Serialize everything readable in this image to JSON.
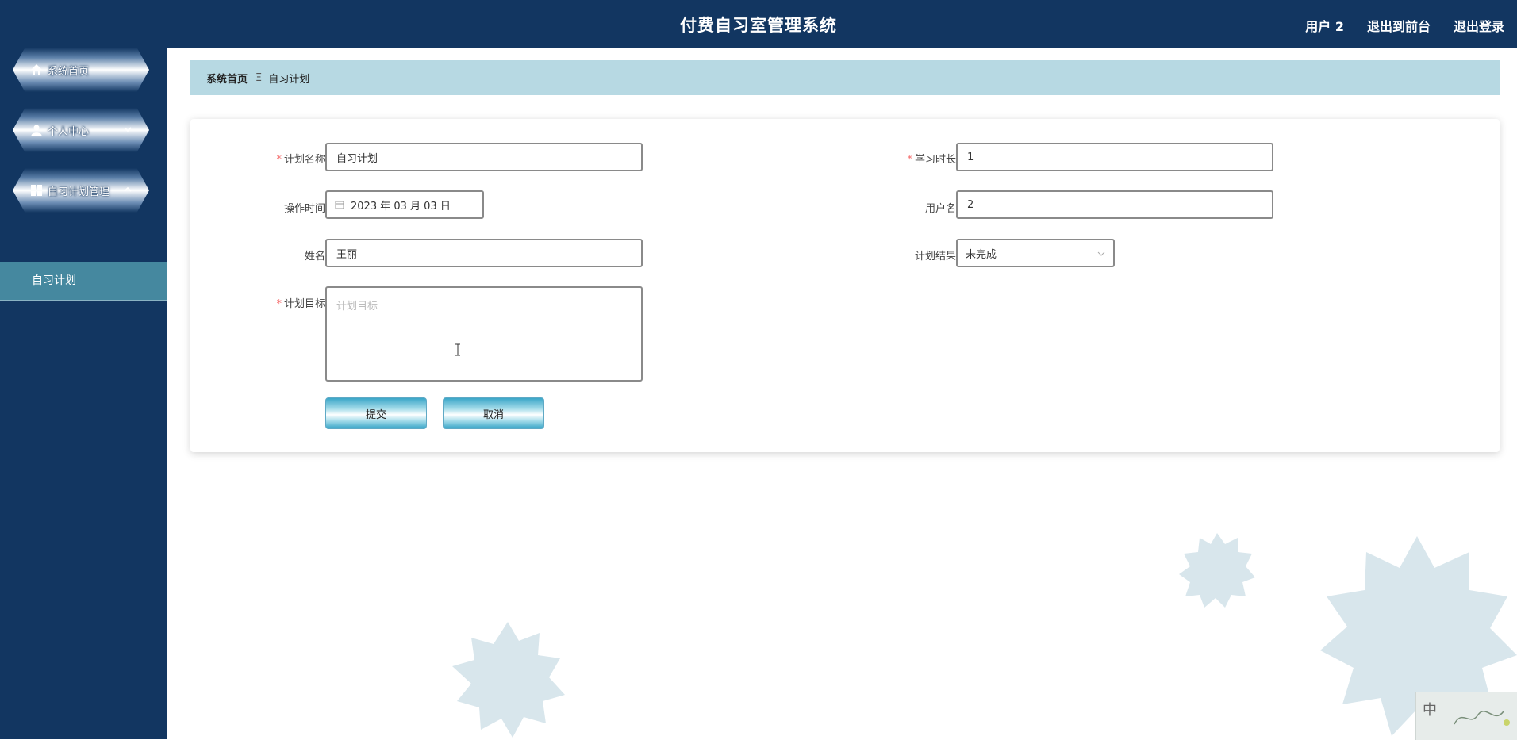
{
  "header": {
    "title": "付费自习室管理系统",
    "user_label": "用户 2",
    "front_link": "退出到前台",
    "logout_link": "退出登录"
  },
  "sidebar": {
    "items": [
      {
        "label": "系统首页",
        "icon": "home-icon"
      },
      {
        "label": "个人中心",
        "icon": "user-icon"
      },
      {
        "label": "自习计划管理",
        "icon": "grid-icon"
      }
    ],
    "submenu": {
      "label": "自习计划"
    }
  },
  "breadcrumb": {
    "home": "系统首页",
    "separator": "Ξ",
    "current": "自习计划"
  },
  "form": {
    "plan_name": {
      "label": "计划名称",
      "value": "自习计划",
      "required": true
    },
    "study_duration": {
      "label": "学习时长",
      "value": "1",
      "required": true
    },
    "operate_time": {
      "label": "操作时间",
      "value": "2023 年 03 月 03 日"
    },
    "username": {
      "label": "用户名",
      "value": "2"
    },
    "name": {
      "label": "姓名",
      "value": "王丽"
    },
    "plan_result": {
      "label": "计划结果",
      "value": "未完成"
    },
    "plan_goal": {
      "label": "计划目标",
      "placeholder": "计划目标",
      "required": true
    },
    "submit_label": "提交",
    "cancel_label": "取消"
  },
  "ime": {
    "mode": "中"
  },
  "colors": {
    "sidebar": "#123661",
    "breadcrumb_bg": "#b7d9e3",
    "submenu_active": "#45889f",
    "required": "#f56c6c"
  }
}
